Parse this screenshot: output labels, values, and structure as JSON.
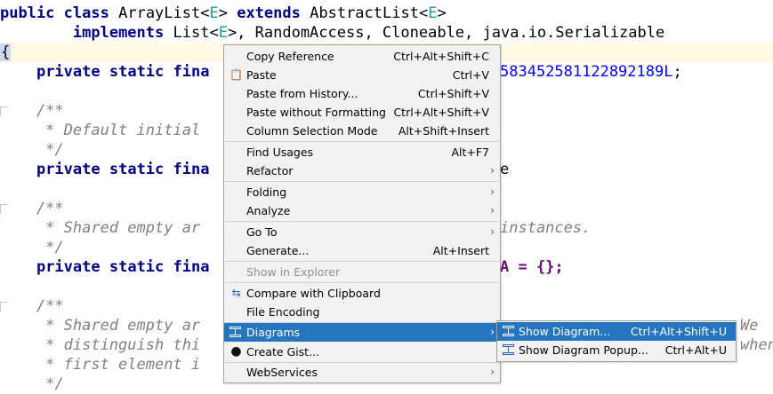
{
  "code": {
    "l1": {
      "k1": "public",
      "k2": "class",
      "t1": "ArrayList<",
      "t2": "E",
      "t3": ">",
      "k3": "extends",
      "t4": "AbstractList<",
      "t5": "E",
      "t6": ">"
    },
    "l2": {
      "indent": "        ",
      "k1": "implements",
      "t1": "List<",
      "t2": "E",
      "t3": ">, RandomAccess, Cloneable, java.io.Serializable"
    },
    "l3": {
      "brace": "{"
    },
    "l4": {
      "indent": "    ",
      "k1": "private",
      "k2": "static",
      "k3": "fina",
      "num": "583452581122892189L",
      "tail": ";"
    },
    "l6": {
      "text": "    /**"
    },
    "l7": {
      "text": "     * Default initial"
    },
    "l8": {
      "text": "     */"
    },
    "l9": {
      "indent": "    ",
      "k1": "private",
      "k2": "static",
      "k3": "fina",
      "tail": "e"
    },
    "l11": {
      "text": "    /**"
    },
    "l12": {
      "pre": "     * Shared empty ar",
      "post": "instances."
    },
    "l13": {
      "text": "     */"
    },
    "l14": {
      "indent": "    ",
      "k1": "private",
      "k2": "static",
      "k3": "fina",
      "tail": "A = {};"
    },
    "l16": {
      "text": "    /**"
    },
    "l17": {
      "pre": "     * Shared empty ar",
      "post": "We"
    },
    "l18": {
      "pre": "     * distinguish thi",
      "post": "when"
    },
    "l19": {
      "text": "     * first element i"
    },
    "l20": {
      "text": "     */"
    }
  },
  "menu": {
    "items": [
      {
        "label": "Copy Reference",
        "shortcut": "Ctrl+Alt+Shift+C"
      },
      {
        "label": "Paste",
        "shortcut": "Ctrl+V",
        "icon": "📋"
      },
      {
        "label": "Paste from History...",
        "shortcut": "Ctrl+Shift+V"
      },
      {
        "label": "Paste without Formatting",
        "shortcut": "Ctrl+Alt+Shift+V"
      },
      {
        "label": "Column Selection Mode",
        "shortcut": "Alt+Shift+Insert"
      },
      {
        "label": "Find Usages",
        "shortcut": "Alt+F7"
      },
      {
        "label": "Refactor",
        "arrow": "›"
      },
      {
        "label": "Folding",
        "arrow": "›"
      },
      {
        "label": "Analyze",
        "arrow": "›"
      },
      {
        "label": "Go To",
        "arrow": "›"
      },
      {
        "label": "Generate...",
        "shortcut": "Alt+Insert"
      },
      {
        "label": "Show in Explorer"
      },
      {
        "label": "Compare with Clipboard",
        "icon": "⇆"
      },
      {
        "label": "File Encoding"
      },
      {
        "label": "Diagrams",
        "arrow": "›"
      },
      {
        "label": "Create Gist...",
        "icon": "●"
      },
      {
        "label": "WebServices",
        "arrow": "›"
      }
    ]
  },
  "submenu": {
    "items": [
      {
        "label": "Show Diagram...",
        "shortcut": "Ctrl+Alt+Shift+U"
      },
      {
        "label": "Show Diagram Popup...",
        "shortcut": "Ctrl+Alt+U"
      }
    ]
  },
  "colors": {
    "selection": "#2675bf",
    "keyword": "#000080",
    "type_param": "#20999d",
    "comment": "#808080",
    "number": "#0000ff"
  }
}
